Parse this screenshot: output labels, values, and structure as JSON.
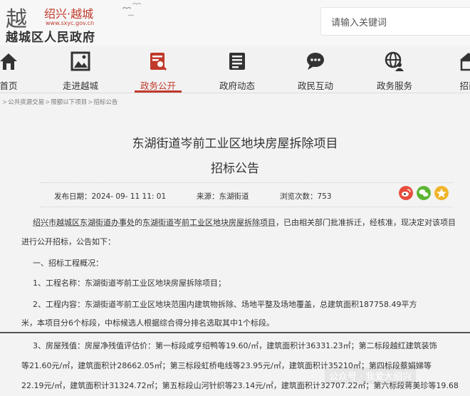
{
  "header": {
    "logo_glyph": "越",
    "brand": "绍兴·越城",
    "url": "www.sxyc.gov.cn",
    "site_name": "越城区人民政府",
    "search_placeholder": "请输入关键词"
  },
  "nav": {
    "items": [
      {
        "label": "首页",
        "icon": "home-icon"
      },
      {
        "label": "走进越城",
        "icon": "picture-icon"
      },
      {
        "label": "政务公开",
        "icon": "document-icon",
        "active": true
      },
      {
        "label": "政府动态",
        "icon": "news-icon"
      },
      {
        "label": "政民互动",
        "icon": "chat-icon"
      },
      {
        "label": "政务服务",
        "icon": "globe-user-icon"
      },
      {
        "label": "招商",
        "icon": "building-icon"
      }
    ]
  },
  "breadcrumb": [
    "公共资源交易",
    "限额以下项目",
    "招标公告"
  ],
  "article": {
    "title": "东湖街道岑前工业区地块房屋拆除项目",
    "subtitle": "招标公告",
    "publish_label": "发布日期：",
    "publish_date": "2024- 09- 11 11: 01",
    "source_label": "来源：",
    "source": "东湖街道",
    "views_label": "浏览次数：",
    "views": "753",
    "intro_org": "绍兴市越城区东湖街道办事处",
    "intro_mid": "的",
    "intro_project": "东湖街道岑前工业区地块房屋拆除项目",
    "intro_rest": "，已由相关部门批准拆迁，经核准，现决定对该项目",
    "intro_line2": "进行公开招标，公告如下：",
    "section1": "一、招标工程概况：",
    "item1": "1、工程名称：东湖街道岑前工业区地块房屋拆除项目；",
    "item2_line1": "2、工程内容：东湖街道岑前工业区地块范围内建筑物拆除、场地平整及场地覆盖，总建筑面积187758.49平方",
    "item2_line2": "米，本项目分6个标段，中标候选人根据综合得分排名选取其中1个标段。",
    "item3_line1": "3、房屋残值：房屋净残值评估价：第一标段咸亨绍鸭等19.60/㎡，建筑面积计36331.23㎡；第二标段越红建筑装饰",
    "item3_line2": "等21.60元/㎡，建筑面积计28662.05㎡；第三标段虹桥电线等23.95元/㎡，建筑面积计35210㎡；第四标段蔡娟娣等",
    "item3_line3": "22.19元/㎡，建筑面积计31324.72㎡；第五标段山河针织等23.14元/㎡，建筑面积计32707.22㎡；第六标段蒋美珍等19.68"
  },
  "watermark": "公众号 · 我爱大绍兴"
}
